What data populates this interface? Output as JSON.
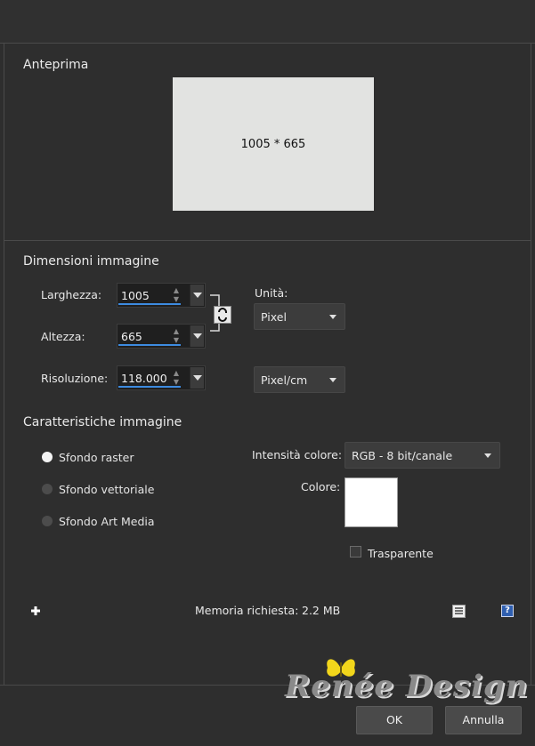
{
  "preview": {
    "title": "Anteprima",
    "dims": "1005 * 665"
  },
  "dimensions": {
    "title": "Dimensioni immagine",
    "width_label": "Larghezza:",
    "width_value": "1005",
    "height_label": "Altezza:",
    "height_value": "665",
    "resolution_label": "Risoluzione:",
    "resolution_value": "118.000",
    "unit_label": "Unità:",
    "unit_value": "Pixel",
    "res_unit_value": "Pixel/cm"
  },
  "characteristics": {
    "title": "Caratteristiche immagine",
    "radios": [
      {
        "label": "Sfondo raster",
        "selected": true
      },
      {
        "label": "Sfondo vettoriale",
        "selected": false
      },
      {
        "label": "Sfondo Art Media",
        "selected": false
      }
    ],
    "color_depth_label": "Intensità colore:",
    "color_depth_value": "RGB - 8 bit/canale",
    "color_label": "Colore:",
    "color_value": "#ffffff",
    "transparent_label": "Trasparente",
    "transparent_checked": false
  },
  "footer": {
    "memory_label": "Memoria richiesta:",
    "memory_value": "2.2 MB"
  },
  "watermark": {
    "text": "Renée Design"
  },
  "buttons": {
    "ok": "OK",
    "cancel": "Annulla"
  }
}
